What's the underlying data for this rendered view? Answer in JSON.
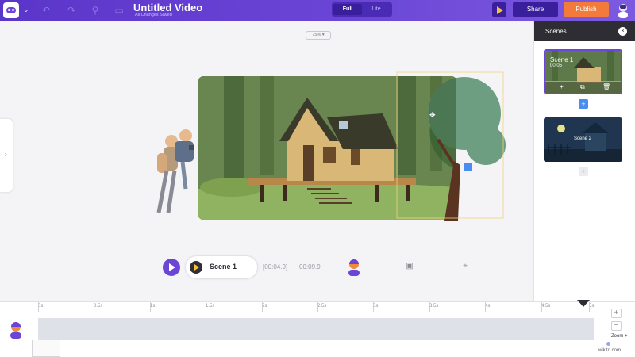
{
  "header": {
    "title": "Untitled Video",
    "subtitle": "All Changes Saved",
    "mode_full": "Full",
    "mode_lite": "Lite",
    "share_label": "Share",
    "publish_label": "Publish"
  },
  "canvas": {
    "zoom": "75% ▾",
    "left_toggle": "›"
  },
  "player": {
    "scene_label": "Scene 1",
    "current_time": "[00:04.9]",
    "total_time": "00:09.9"
  },
  "scenes_panel": {
    "title": "Scenes",
    "close": "×",
    "scenes": [
      {
        "name": "Scene 1",
        "duration": "00:05"
      },
      {
        "name": "Scene 2"
      }
    ],
    "add": "+"
  },
  "timeline": {
    "ticks": [
      "0s",
      "0.5s",
      "1s",
      "1.5s",
      "2s",
      "2.5s",
      "3s",
      "3.5s",
      "4s",
      "4.5s",
      "5s"
    ],
    "zoom_in": "+",
    "zoom_out": "−",
    "zoom_label": "Zoom",
    "zoom_minus": "-",
    "zoom_plus": "+",
    "watermark": "wikitd.com"
  },
  "colors": {
    "accent": "#6b46d6",
    "publish": "#f27a3a",
    "panel_dark": "#2d2d33"
  }
}
